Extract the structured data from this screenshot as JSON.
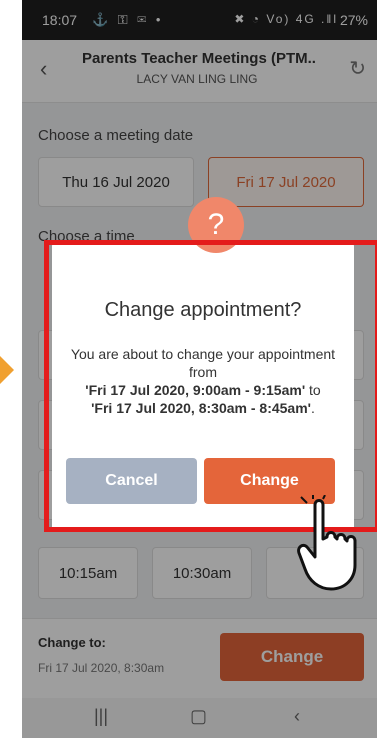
{
  "status_bar": {
    "time": "18:07",
    "battery": "27%",
    "left_icons": "⚓ ⚿ ✉ •",
    "right_icons": "✖ ◔ Vo) 4G .‖l"
  },
  "header": {
    "title": "Parents Teacher Meetings (PTM..",
    "subtitle": "LACY VAN LING LING"
  },
  "background": {
    "date_section_label": "Choose a meeting date",
    "date_options": [
      "Thu 16 Jul 2020",
      "Fri 17 Jul 2020"
    ],
    "selected_date_index": 1,
    "time_section_label": "Choose a time",
    "time_options": [
      "10:15am",
      "10:30am"
    ]
  },
  "footer": {
    "change_to_label": "Change to:",
    "change_to_value": "Fri 17 Jul 2020, 8:30am",
    "change_button": "Change"
  },
  "modal": {
    "icon": "?",
    "title": "Change appointment?",
    "body_text_1": "You are about to change your appointment from",
    "from_value": "'Fri 17 Jul 2020, 9:00am - 9:15am'",
    "body_text_2": "to",
    "to_value": "'Fri 17 Jul 2020, 8:30am - 8:45am'",
    "body_text_3": ".",
    "cancel_label": "Cancel",
    "change_label": "Change"
  },
  "colors": {
    "accent": "#e4653a",
    "highlight": "#e41b1b",
    "cancel": "#a6b1c2"
  }
}
